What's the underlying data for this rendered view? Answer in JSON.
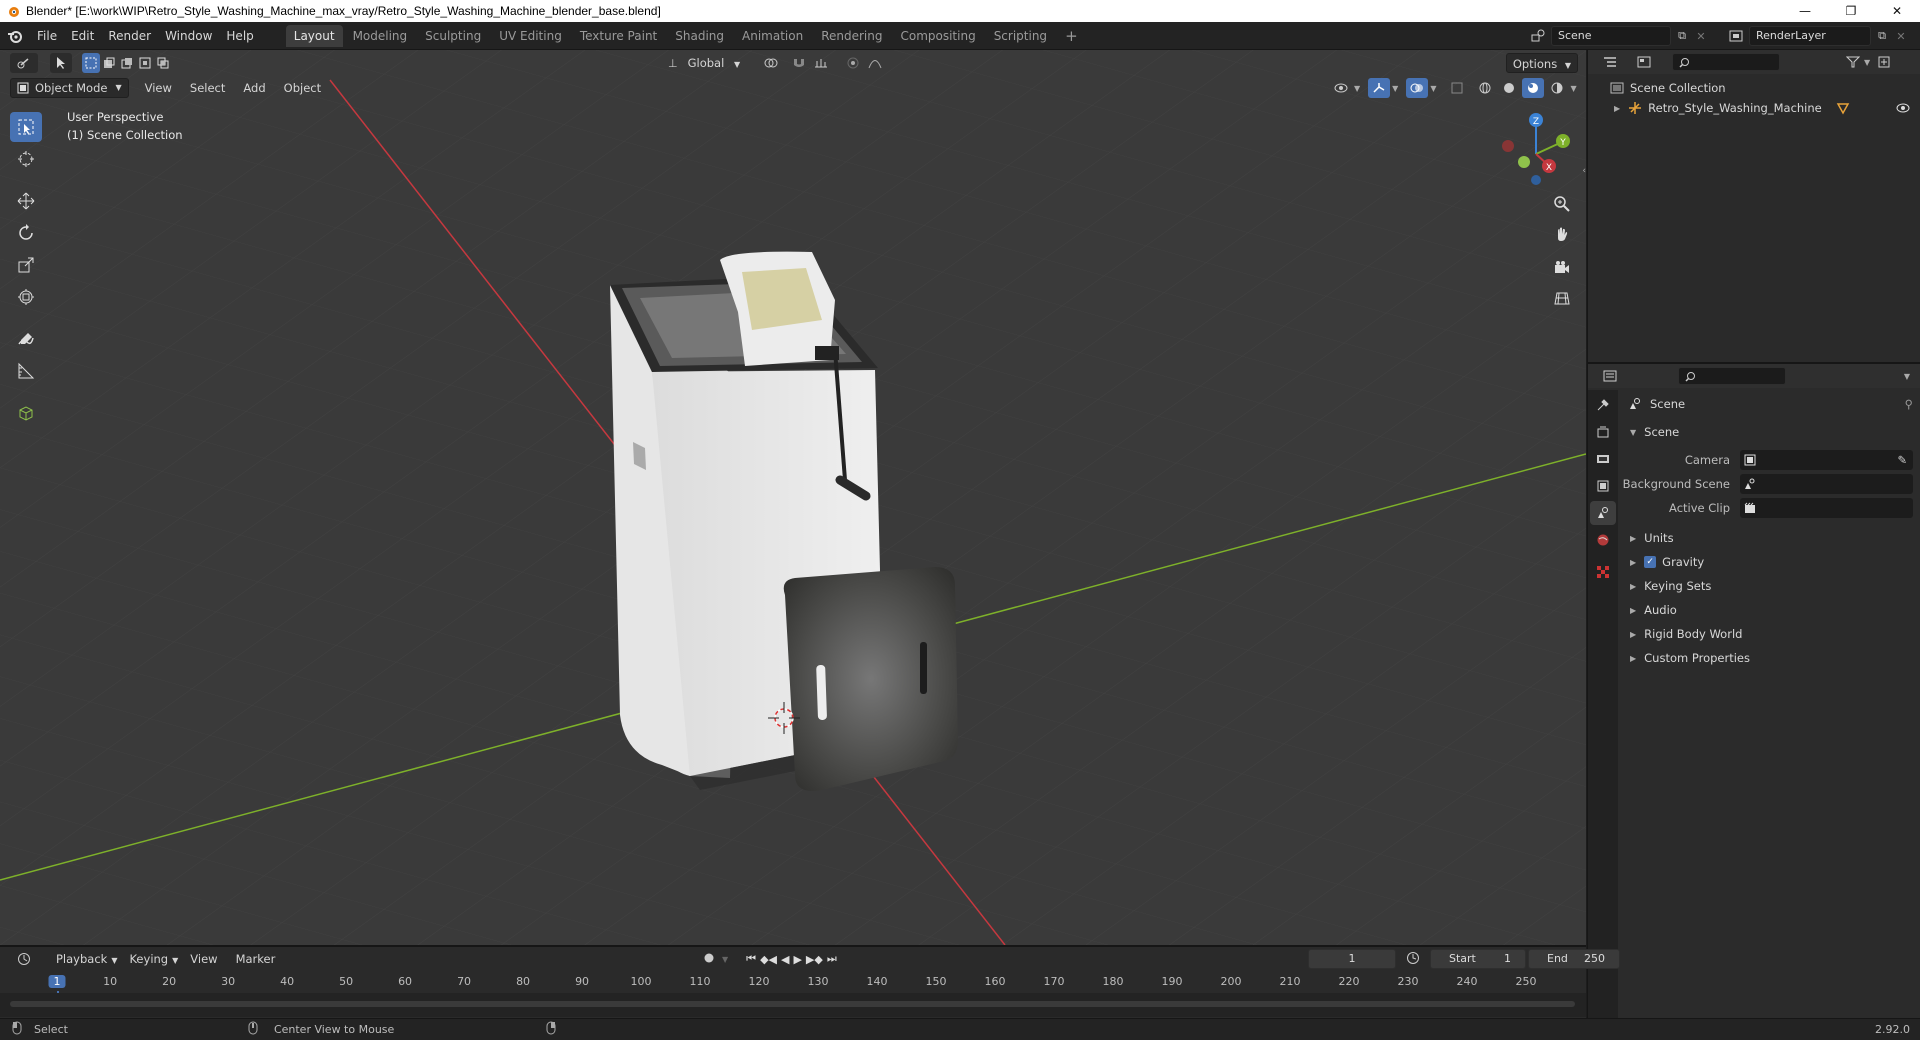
{
  "window": {
    "title": "Blender* [E:\\work\\WIP\\Retro_Style_Washing_Machine_max_vray/Retro_Style_Washing_Machine_blender_base.blend]",
    "minimize": "—",
    "maximize": "❐",
    "close": "✕"
  },
  "menu": {
    "items": [
      "File",
      "Edit",
      "Render",
      "Window",
      "Help"
    ]
  },
  "workspaces": {
    "tabs": [
      "Layout",
      "Modeling",
      "Sculpting",
      "UV Editing",
      "Texture Paint",
      "Shading",
      "Animation",
      "Rendering",
      "Compositing",
      "Scripting"
    ],
    "active": "Layout",
    "add": "+"
  },
  "scene_selector": {
    "value": "Scene"
  },
  "renderlayer_selector": {
    "value": "RenderLayer"
  },
  "viewport": {
    "transform_orientation": "Global",
    "options_label": "Options",
    "mode": "Object Mode",
    "menus": [
      "View",
      "Select",
      "Add",
      "Object"
    ],
    "overlay_line1": "User Perspective",
    "overlay_line2": "(1) Scene Collection",
    "gizmo": {
      "x": "X",
      "y": "Y",
      "z": "Z"
    }
  },
  "outliner": {
    "root": "Scene Collection",
    "items": [
      {
        "label": "Retro_Style_Washing_Machine"
      }
    ]
  },
  "properties": {
    "context_title": "Scene",
    "panel_title": "Scene",
    "fields": [
      {
        "label": "Camera",
        "value": ""
      },
      {
        "label": "Background Scene",
        "value": ""
      },
      {
        "label": "Active Clip",
        "value": ""
      }
    ],
    "subpanels": [
      "Units",
      "Gravity",
      "Keying Sets",
      "Audio",
      "Rigid Body World",
      "Custom Properties"
    ],
    "gravity_checked": true
  },
  "timeline": {
    "menus": [
      "Playback",
      "Keying",
      "View",
      "Marker"
    ],
    "current_frame": "1",
    "start_label": "Start",
    "start_value": "1",
    "end_label": "End",
    "end_value": "250",
    "ruler": [
      "1",
      "10",
      "20",
      "30",
      "40",
      "50",
      "60",
      "70",
      "80",
      "90",
      "100",
      "110",
      "120",
      "130",
      "140",
      "150",
      "160",
      "170",
      "180",
      "190",
      "200",
      "210",
      "220",
      "230",
      "240",
      "250"
    ]
  },
  "statusbar": {
    "left": "Select",
    "middle": "Center View to Mouse",
    "version": "2.92.0"
  },
  "colors": {
    "accent": "#4772b3",
    "x_axis": "#c5383f",
    "y_axis": "#7eb12a",
    "z_axis": "#3b83d6"
  }
}
